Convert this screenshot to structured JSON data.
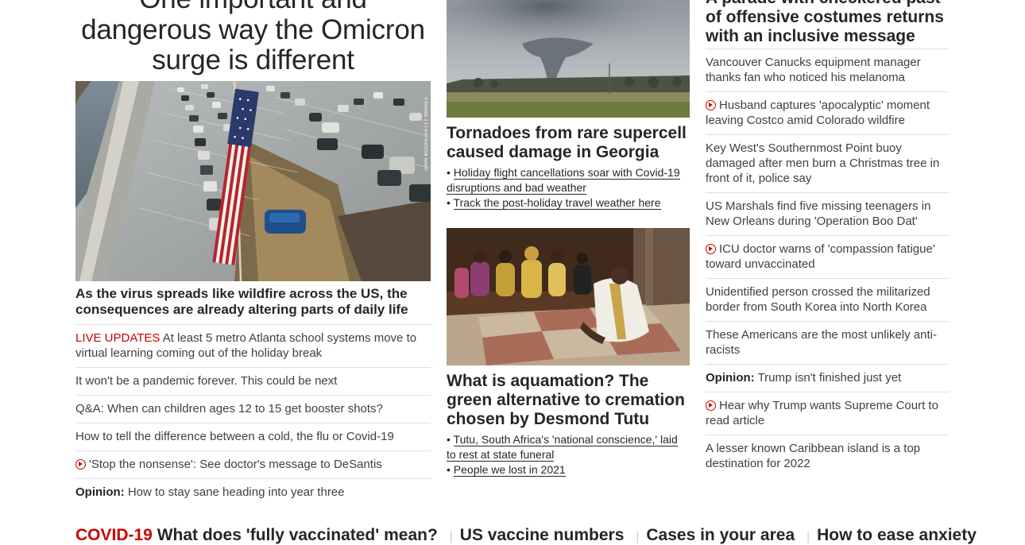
{
  "col1": {
    "hero_title": "One important and dangerous way the Omicron surge is different",
    "photo_credit": "John Moore/Getty Images",
    "hero_caption": "As the virus spreads like wildfire across the US, the consequences are already altering parts of daily life",
    "items": [
      {
        "prefix": "LIVE UPDATES",
        "text": "At least 5 metro Atlanta school systems move to virtual learning coming out of the holiday break"
      },
      {
        "text": "It won't be a pandemic forever. This could be next"
      },
      {
        "text": "Q&A: When can children ages 12 to 15 get booster shots?"
      },
      {
        "text": "How to tell the difference between a cold, the flu or Covid-19"
      },
      {
        "video": true,
        "text": "'Stop the nonsense': See doctor's message to DeSantis"
      },
      {
        "bold": "Opinion:",
        "text": "How to stay sane heading into year three"
      }
    ]
  },
  "col2": {
    "story1": {
      "title": "Tornadoes from rare supercell caused damage in Georgia",
      "links": [
        "Holiday flight cancellations soar with Covid-19 disruptions and bad weather",
        "Track the post-holiday travel weather here"
      ]
    },
    "story2": {
      "title": "What is aquamation? The green alternative to cremation chosen by Desmond Tutu",
      "links": [
        "Tutu, South Africa's 'national conscience,' laid to rest at state funeral",
        "People we lost in 2021"
      ]
    },
    "bullet": "•"
  },
  "col3": {
    "headline": "A parade with checkered past of offensive costumes returns with an inclusive message",
    "items": [
      {
        "text": "Vancouver Canucks equipment manager thanks fan who noticed his melanoma"
      },
      {
        "video": true,
        "text": "Husband captures 'apocalyptic' moment leaving Costco amid Colorado wildfire"
      },
      {
        "text": "Key West's Southernmost Point buoy damaged after men burn a Christmas tree in front of it, police say"
      },
      {
        "text": "US Marshals find five missing teenagers in New Orleans during 'Operation Boo Dat'"
      },
      {
        "video": true,
        "text": "ICU doctor warns of 'compassion fatigue' toward unvaccinated"
      },
      {
        "text": "Unidentified person crossed the militarized border from South Korea into North Korea"
      },
      {
        "text": "These Americans are the most unlikely anti-racists"
      },
      {
        "bold": "Opinion:",
        "text": "Trump isn't finished just yet"
      },
      {
        "video": true,
        "text": "Hear why Trump wants Supreme Court to read article"
      },
      {
        "text": "A lesser known Caribbean island is a top destination for 2022"
      }
    ]
  },
  "bottom_bar": {
    "label": "COVID-19",
    "links": [
      "What does 'fully vaccinated' mean?",
      "US vaccine numbers",
      "Cases in your area",
      "How to ease anxiety"
    ],
    "separator": "|"
  },
  "colors": {
    "accent_red": "#cc0000",
    "text": "#262626",
    "divider": "#e1e1e1"
  },
  "icons": {
    "video": "play-circle-icon"
  }
}
